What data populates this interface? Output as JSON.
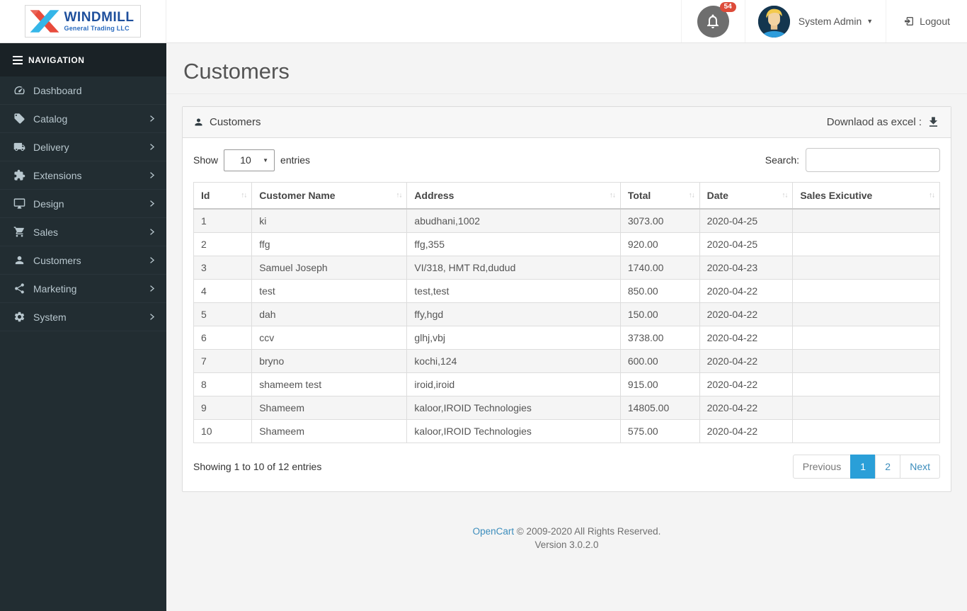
{
  "brand": {
    "name": "WINDMILL",
    "tagline": "General Trading LLC"
  },
  "topbar": {
    "notification_count": "54",
    "user_name": "System Admin",
    "logout_label": "Logout"
  },
  "sidebar": {
    "header": "NAVIGATION",
    "items": [
      {
        "label": "Dashboard",
        "icon": "tachometer-icon",
        "has_children": false
      },
      {
        "label": "Catalog",
        "icon": "tag-icon",
        "has_children": true
      },
      {
        "label": "Delivery",
        "icon": "truck-icon",
        "has_children": true
      },
      {
        "label": "Extensions",
        "icon": "puzzle-icon",
        "has_children": true
      },
      {
        "label": "Design",
        "icon": "desktop-icon",
        "has_children": true
      },
      {
        "label": "Sales",
        "icon": "cart-icon",
        "has_children": true
      },
      {
        "label": "Customers",
        "icon": "user-icon",
        "has_children": true
      },
      {
        "label": "Marketing",
        "icon": "share-icon",
        "has_children": true
      },
      {
        "label": "System",
        "icon": "gear-icon",
        "has_children": true
      }
    ]
  },
  "page": {
    "title": "Customers"
  },
  "panel": {
    "title": "Customers",
    "download_label": "Downlaod as excel :"
  },
  "table_controls": {
    "show_label": "Show",
    "page_length": "10",
    "entries_label": "entries",
    "search_label": "Search:",
    "search_value": ""
  },
  "table": {
    "column_keys": [
      "id",
      "name",
      "address",
      "total",
      "date",
      "sales_executive"
    ],
    "columns": [
      {
        "key": "id",
        "label": "Id"
      },
      {
        "key": "name",
        "label": "Customer Name"
      },
      {
        "key": "address",
        "label": "Address"
      },
      {
        "key": "total",
        "label": "Total"
      },
      {
        "key": "date",
        "label": "Date"
      },
      {
        "key": "sales_executive",
        "label": "Sales Exicutive"
      }
    ],
    "rows": [
      {
        "id": "1",
        "name": "ki",
        "address": "abudhani,1002",
        "total": "3073.00",
        "date": "2020-04-25",
        "sales_executive": ""
      },
      {
        "id": "2",
        "name": "ffg",
        "address": "ffg,355",
        "total": "920.00",
        "date": "2020-04-25",
        "sales_executive": ""
      },
      {
        "id": "3",
        "name": "Samuel Joseph",
        "address": "VI/318, HMT Rd,dudud",
        "total": "1740.00",
        "date": "2020-04-23",
        "sales_executive": ""
      },
      {
        "id": "4",
        "name": "test",
        "address": "test,test",
        "total": "850.00",
        "date": "2020-04-22",
        "sales_executive": ""
      },
      {
        "id": "5",
        "name": "dah",
        "address": "ffy,hgd",
        "total": "150.00",
        "date": "2020-04-22",
        "sales_executive": ""
      },
      {
        "id": "6",
        "name": "ccv",
        "address": "glhj,vbj",
        "total": "3738.00",
        "date": "2020-04-22",
        "sales_executive": ""
      },
      {
        "id": "7",
        "name": "bryno",
        "address": "kochi,124",
        "total": "600.00",
        "date": "2020-04-22",
        "sales_executive": ""
      },
      {
        "id": "8",
        "name": "shameem test",
        "address": "iroid,iroid",
        "total": "915.00",
        "date": "2020-04-22",
        "sales_executive": ""
      },
      {
        "id": "9",
        "name": "Shameem",
        "address": "kaloor,IROID Technologies",
        "total": "14805.00",
        "date": "2020-04-22",
        "sales_executive": ""
      },
      {
        "id": "10",
        "name": "Shameem",
        "address": "kaloor,IROID Technologies",
        "total": "575.00",
        "date": "2020-04-22",
        "sales_executive": ""
      }
    ]
  },
  "table_footer": {
    "info": "Showing 1 to 10 of 12 entries",
    "pagination": {
      "previous": "Previous",
      "pages": [
        "1",
        "2"
      ],
      "active_page": "1",
      "next": "Next"
    }
  },
  "footer": {
    "link": "OpenCart",
    "copyright": "© 2009-2020 All Rights Reserved.",
    "version": "Version 3.0.2.0"
  },
  "colors": {
    "sidebar_bg": "#222d32",
    "sidebar_header_bg": "#1a2226",
    "sidebar_text": "#b8c7ce",
    "active_page_bg": "#2a9fd8",
    "link_blue": "#3c8dbc",
    "badge_red": "#dd4b39",
    "logo_blue": "#1e4f9c",
    "logo_red": "#e84b3c",
    "logo_cyan": "#35b6e8",
    "stripe_row": "#f5f5f5"
  }
}
